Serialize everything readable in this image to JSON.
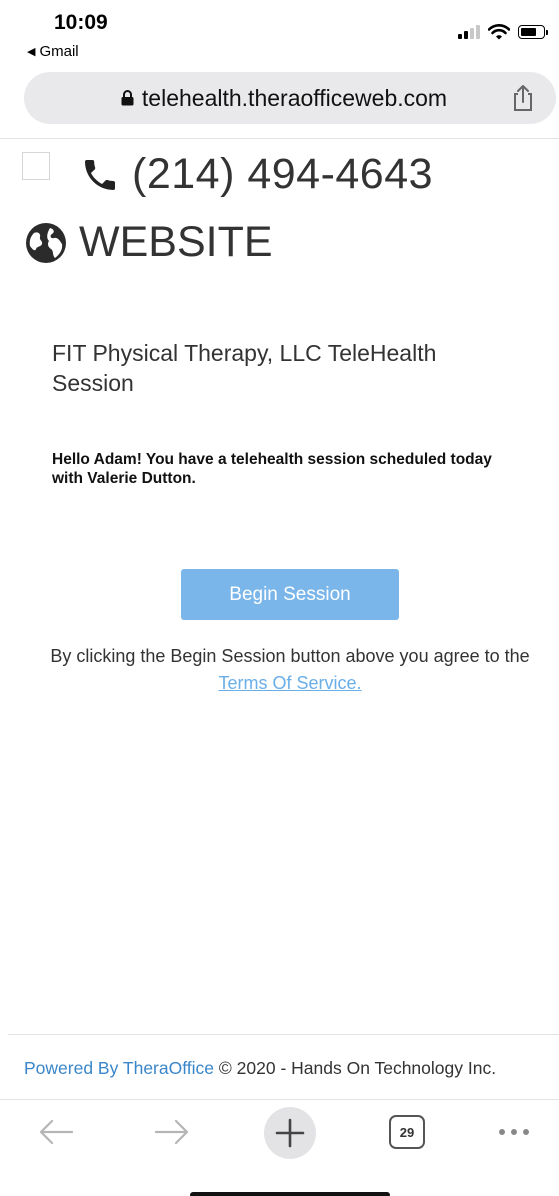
{
  "status_bar": {
    "time": "10:09",
    "back_app": "Gmail"
  },
  "url_bar": {
    "url": "telehealth.theraofficeweb.com"
  },
  "contact": {
    "phone": "(214) 494-4643",
    "website_label": "WEBSITE"
  },
  "main": {
    "title": "FIT Physical Therapy, LLC TeleHealth Session",
    "greeting": "Hello Adam! You have a telehealth session scheduled today with Valerie Dutton.",
    "begin_button": "Begin Session",
    "agree_text": "By clicking the Begin Session button above you agree to the",
    "tos_link": "Terms Of Service."
  },
  "footer": {
    "powered_by": "Powered By TheraOffice",
    "copyright": "© 2020 - Hands On Technology Inc."
  },
  "toolbar": {
    "tab_count": "29"
  },
  "colors": {
    "button_bg": "#7ab6ea",
    "link": "#6aaee8",
    "brand_link": "#3a86c8"
  }
}
